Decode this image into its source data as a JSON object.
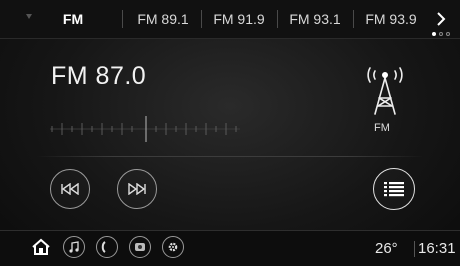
{
  "tabs": {
    "items": [
      {
        "label": "FM",
        "active": true
      },
      {
        "label": "FM 89.1",
        "active": false
      },
      {
        "label": "FM 91.9",
        "active": false
      },
      {
        "label": "FM 93.1",
        "active": false
      },
      {
        "label": "FM 93.9",
        "active": false
      }
    ],
    "next_icon": "chevron-right-icon",
    "page_indicator": {
      "count": 3,
      "current": 1
    }
  },
  "now_playing": {
    "frequency": "FM 87.0",
    "band_label": "FM",
    "band_icon": "radio-antenna-icon"
  },
  "controls": {
    "prev_icon": "skip-previous-icon",
    "next_icon": "skip-next-icon",
    "list_icon": "list-icon"
  },
  "bottom_bar": {
    "icons": [
      "home-icon",
      "music-icon",
      "phone-icon",
      "camera-icon",
      "settings-icon"
    ],
    "temperature": "26°",
    "time": "16:31"
  },
  "colors": {
    "background": "#0a0a0a",
    "text": "#ffffff",
    "muted": "#9a9a9a"
  }
}
